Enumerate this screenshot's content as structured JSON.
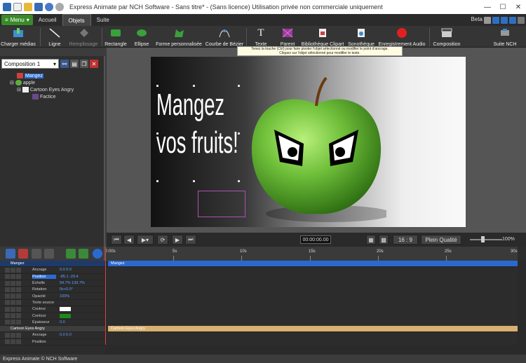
{
  "window": {
    "title": "Express Animate par NCH Software - Sans titre* - (Sans licence) Utilisation privée non commerciale uniquement"
  },
  "tabs": {
    "menu_label": "Menu",
    "items": [
      {
        "label": "Accueil",
        "active": false
      },
      {
        "label": "Objets",
        "active": true
      },
      {
        "label": "Suite",
        "active": false
      }
    ],
    "beta": "Beta"
  },
  "ribbon": {
    "load_media": "Charger médias",
    "line": "Ligne",
    "fill": "Remplissage",
    "rectangle": "Rectangle",
    "ellipse": "Ellipse",
    "custom_shape": "Forme personnalisée",
    "bezier": "Courbe de Bézier",
    "text": "Texte",
    "parent": "Parent",
    "clipart": "Bibliothèque Clipart",
    "sound_library": "Sonothèque",
    "audio_record": "Enregistrement Audio",
    "composition": "Composition",
    "nch_suite": "Suite NCH"
  },
  "tooltip": {
    "line1": "Tenez la touche (Ctrl) pour faire pivoter l'objet sélectionné ou modifier le point d'ancrage.",
    "line2": "Cliquez sur l'objet sélectionné pour modifier le texte."
  },
  "composition": {
    "selected": "Composition 1",
    "tree": [
      {
        "label": "Mangez",
        "selected": true
      },
      {
        "label": "apple",
        "selected": false
      },
      {
        "label": "Cartoon Eyes Angry",
        "selected": false
      },
      {
        "label": "Factice",
        "selected": false
      }
    ]
  },
  "canvas": {
    "text_line1": "Mangez",
    "text_line2": "vos fruits!"
  },
  "playback": {
    "time": "00:00:00.00",
    "aspect": "16 : 9",
    "quality": "Plein Qualité",
    "zoom": "100%",
    "zoom_level": 0.5
  },
  "timeline": {
    "ruler": [
      "0:00s",
      "5s",
      "10s",
      "15s",
      "20s",
      "25s",
      "30s"
    ],
    "rows": [
      {
        "type": "layer",
        "label": "Mangez",
        "value": ""
      },
      {
        "type": "prop",
        "label": "Ancrage",
        "value": "0.0    0.0"
      },
      {
        "type": "prop",
        "label": "Position",
        "value": "-85.1    -29.4"
      },
      {
        "type": "prop",
        "label": "Échelle",
        "value": "54.7%   139.7%"
      },
      {
        "type": "prop",
        "label": "Rotation",
        "value": "0x+0.0°"
      },
      {
        "type": "prop",
        "label": "Opacité",
        "value": "100%"
      },
      {
        "type": "prop",
        "label": "Texte source",
        "value": ""
      },
      {
        "type": "prop",
        "label": "Couleur",
        "value": ""
      },
      {
        "type": "prop",
        "label": "Contour",
        "value": ""
      },
      {
        "type": "prop",
        "label": "Épaisseur",
        "value": "0.0"
      },
      {
        "type": "layer2",
        "label": "Cartoon Eyes Angry",
        "value": ""
      },
      {
        "type": "prop",
        "label": "Ancrage",
        "value": "0.0    0.0"
      },
      {
        "type": "prop",
        "label": "Position",
        "value": ""
      }
    ],
    "track_mangez": "Mangez",
    "track_eyes": "Cartoon Eyes Angry",
    "color_swatch": "#ffffff",
    "outline_swatch": "#1a8a1a"
  },
  "status": {
    "text": "Express Animate © NCH Software"
  },
  "colors": {
    "accent": "#2a6ad0",
    "menu_green": "#3a8a2a",
    "apple_green": "#6fbf3a"
  }
}
